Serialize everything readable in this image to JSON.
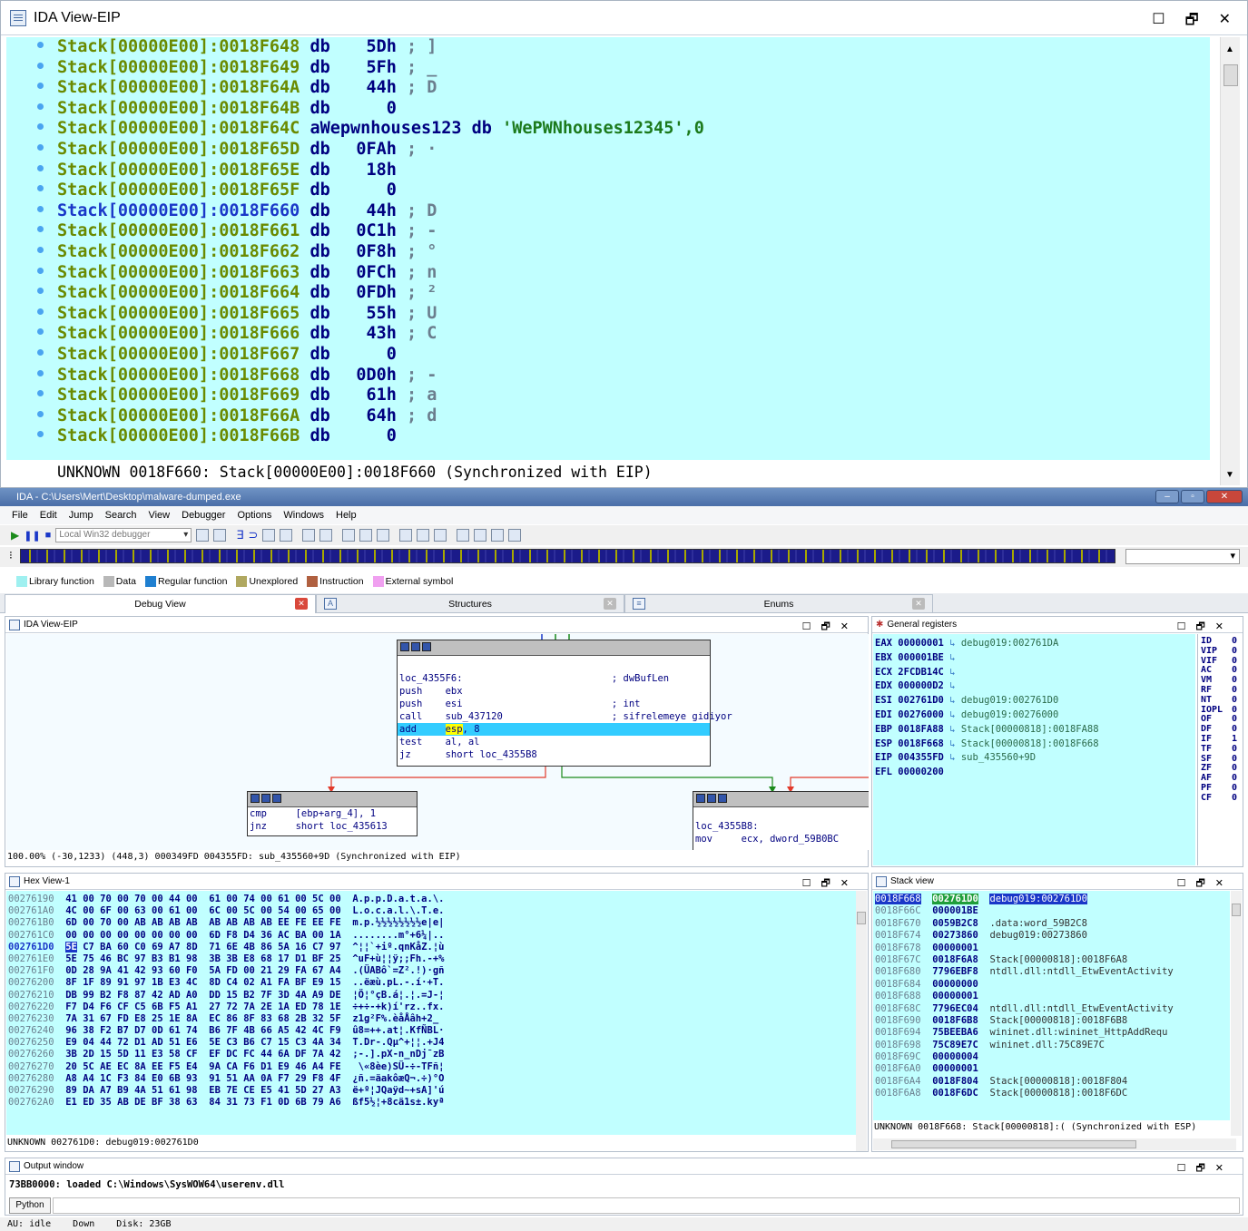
{
  "top_view": {
    "title": "IDA View-EIP",
    "lines": [
      {
        "addr": "Stack[00000E00]:0018F648",
        "op": "db",
        "val": "5Dh",
        "cmt": "; ]"
      },
      {
        "addr": "Stack[00000E00]:0018F649",
        "op": "db",
        "val": "5Fh",
        "cmt": "; _"
      },
      {
        "addr": "Stack[00000E00]:0018F64A",
        "op": "db",
        "val": "44h",
        "cmt": "; D"
      },
      {
        "addr": "Stack[00000E00]:0018F64B",
        "op": "db",
        "val": "0",
        "cmt": ""
      },
      {
        "addr": "Stack[00000E00]:0018F64C",
        "op": "aWepwnhouses123 db",
        "val": "'WePWNhouses12345',0",
        "cmt": "",
        "str": true
      },
      {
        "addr": "Stack[00000E00]:0018F65D",
        "op": "db",
        "val": "0FAh",
        "cmt": "; ·"
      },
      {
        "addr": "Stack[00000E00]:0018F65E",
        "op": "db",
        "val": "18h",
        "cmt": ""
      },
      {
        "addr": "Stack[00000E00]:0018F65F",
        "op": "db",
        "val": "0",
        "cmt": ""
      },
      {
        "addr": "Stack[00000E00]:0018F660",
        "op": "db",
        "val": "44h",
        "cmt": "; D",
        "sel": true
      },
      {
        "addr": "Stack[00000E00]:0018F661",
        "op": "db",
        "val": "0C1h",
        "cmt": "; -"
      },
      {
        "addr": "Stack[00000E00]:0018F662",
        "op": "db",
        "val": "0F8h",
        "cmt": "; °"
      },
      {
        "addr": "Stack[00000E00]:0018F663",
        "op": "db",
        "val": "0FCh",
        "cmt": "; n"
      },
      {
        "addr": "Stack[00000E00]:0018F664",
        "op": "db",
        "val": "0FDh",
        "cmt": "; ²"
      },
      {
        "addr": "Stack[00000E00]:0018F665",
        "op": "db",
        "val": "55h",
        "cmt": "; U"
      },
      {
        "addr": "Stack[00000E00]:0018F666",
        "op": "db",
        "val": "43h",
        "cmt": "; C"
      },
      {
        "addr": "Stack[00000E00]:0018F667",
        "op": "db",
        "val": "0",
        "cmt": ""
      },
      {
        "addr": "Stack[00000E00]:0018F668",
        "op": "db",
        "val": "0D0h",
        "cmt": "; -"
      },
      {
        "addr": "Stack[00000E00]:0018F669",
        "op": "db",
        "val": "61h",
        "cmt": "; a"
      },
      {
        "addr": "Stack[00000E00]:0018F66A",
        "op": "db",
        "val": "64h",
        "cmt": "; d"
      },
      {
        "addr": "Stack[00000E00]:0018F66B",
        "op": "db",
        "val": "0",
        "cmt": ""
      }
    ],
    "status": "UNKNOWN 0018F660: Stack[00000E00]:0018F660 (Synchronized with EIP)"
  },
  "window": {
    "title": "IDA - C:\\Users\\Mert\\Desktop\\malware-dumped.exe",
    "menu": [
      "File",
      "Edit",
      "Jump",
      "Search",
      "View",
      "Debugger",
      "Options",
      "Windows",
      "Help"
    ],
    "debugger_select": "Local Win32 debugger"
  },
  "legend": [
    {
      "label": "Library function",
      "color": "#9ff0f0"
    },
    {
      "label": "Data",
      "color": "#b8b8b8"
    },
    {
      "label": "Regular function",
      "color": "#1f7fd0"
    },
    {
      "label": "Unexplored",
      "color": "#b0a860"
    },
    {
      "label": "Instruction",
      "color": "#b06040"
    },
    {
      "label": "External symbol",
      "color": "#f0a0f0"
    }
  ],
  "tabs": [
    "Debug View",
    "Structures",
    "Enums"
  ],
  "graph_view": {
    "title": "IDA View-EIP",
    "main_block": [
      {
        "t": "loc_4355F6:                          ; dwBufLen"
      },
      {
        "t": "push    ebx"
      },
      {
        "t": "push    esi                          ; int"
      },
      {
        "t": "call    sub_437120                   ; sifrelemeye gidiyor"
      },
      {
        "t": "add     esp, 8",
        "hl": true
      },
      {
        "t": "test    al, al"
      },
      {
        "t": "jz      short loc_4355B8"
      }
    ],
    "left_block": [
      {
        "t": "cmp     [ebp+arg_4], 1"
      },
      {
        "t": "jnz     short loc_435613"
      }
    ],
    "right_block": [
      {
        "t": "loc_4355B8:"
      },
      {
        "t": "mov     ecx, dword_59B0BC"
      }
    ],
    "status": "100.00% (-30,1233) (448,3) 000349FD 004355FD: sub_435560+9D (Synchronized with EIP)"
  },
  "registers": {
    "title": "General registers",
    "rows": [
      {
        "n": "EAX",
        "v": "00000001",
        "d": "debug019:002761DA"
      },
      {
        "n": "EBX",
        "v": "000001BE",
        "d": ""
      },
      {
        "n": "ECX",
        "v": "2FCDB14C",
        "d": ""
      },
      {
        "n": "EDX",
        "v": "000000D2",
        "d": ""
      },
      {
        "n": "ESI",
        "v": "002761D0",
        "d": "debug019:002761D0"
      },
      {
        "n": "EDI",
        "v": "00276000",
        "d": "debug019:00276000"
      },
      {
        "n": "EBP",
        "v": "0018FA88",
        "d": "Stack[00000818]:0018FA88"
      },
      {
        "n": "ESP",
        "v": "0018F668",
        "d": "Stack[00000818]:0018F668"
      },
      {
        "n": "EIP",
        "v": "004355FD",
        "d": "sub_435560+9D"
      },
      {
        "n": "EFL",
        "v": "00000200",
        "d": ""
      }
    ],
    "flags": [
      {
        "n": "ID",
        "v": "0"
      },
      {
        "n": "VIP",
        "v": "0"
      },
      {
        "n": "VIF",
        "v": "0"
      },
      {
        "n": "AC",
        "v": "0"
      },
      {
        "n": "VM",
        "v": "0"
      },
      {
        "n": "RF",
        "v": "0"
      },
      {
        "n": "NT",
        "v": "0"
      },
      {
        "n": "IOPL",
        "v": "0"
      },
      {
        "n": "OF",
        "v": "0"
      },
      {
        "n": "DF",
        "v": "0"
      },
      {
        "n": "IF",
        "v": "1"
      },
      {
        "n": "TF",
        "v": "0"
      },
      {
        "n": "SF",
        "v": "0"
      },
      {
        "n": "ZF",
        "v": "0"
      },
      {
        "n": "AF",
        "v": "0"
      },
      {
        "n": "PF",
        "v": "0"
      },
      {
        "n": "CF",
        "v": "0"
      }
    ]
  },
  "hex_view": {
    "title": "Hex View-1",
    "rows": [
      {
        "a": "00276190",
        "h": "41 00 70 00 70 00 44 00  61 00 74 00 61 00 5C 00",
        "s": "A.p.p.D.a.t.a.\\."
      },
      {
        "a": "002761A0",
        "h": "4C 00 6F 00 63 00 61 00  6C 00 5C 00 54 00 65 00",
        "s": "L.o.c.a.l.\\.T.e."
      },
      {
        "a": "002761B0",
        "h": "6D 00 70 00 AB AB AB AB  AB AB AB AB EE FE EE FE",
        "s": "m.p.½½½½½½½½e|e|"
      },
      {
        "a": "002761C0",
        "h": "00 00 00 00 00 00 00 00  6D F8 D4 36 AC BA 00 1A",
        "s": "........m°+6¼|.."
      },
      {
        "a": "002761D0",
        "sel": "5E",
        "h": " C7 BA 60 C0 69 A7 8D  71 6E 4B 86 5A 16 C7 97",
        "s": "^¦¦`+iº.qnKåZ.¦ù",
        "cur": true
      },
      {
        "a": "002761E0",
        "h": "5E 75 46 BC 97 B3 B1 98  3B 3B E8 68 17 D1 BF 25",
        "s": "^uF+ù¦¦ÿ;;Fh.-+%"
      },
      {
        "a": "002761F0",
        "h": "0D 28 9A 41 42 93 60 F0  5A FD 00 21 29 FA 67 A4",
        "s": ".(ÜABô`=Z².!)·gñ"
      },
      {
        "a": "00276200",
        "h": "8F 1F 89 91 97 1B E3 4C  8D C4 02 A1 FA BF E9 15",
        "s": "..ëæù.pL.-.í·+T."
      },
      {
        "a": "00276210",
        "h": "DB 99 B2 F8 87 42 AD A0  DD 15 B2 7F 3D 4A A9 DE",
        "s": "¦Ö¦°çB.á¦.¦.=J-¦"
      },
      {
        "a": "00276220",
        "h": "F7 D4 F6 CF C5 6B F5 A1  27 72 7A 2E 1A ED 78 1E",
        "s": "÷+÷-+k)í'rz..fx."
      },
      {
        "a": "00276230",
        "h": "7A 31 67 FD E8 25 1E 8A  EC 86 8F 83 68 2B 32 5F",
        "s": "z1g²F%.èåÅâh+2_"
      },
      {
        "a": "00276240",
        "h": "96 38 F2 B7 D7 0D 61 74  B6 7F 4B 66 A5 42 4C F9",
        "s": "û8=++.at¦.KfÑBL·"
      },
      {
        "a": "00276250",
        "h": "E9 04 44 72 D1 AD 51 E6  5E C3 B6 C7 15 C3 4A 34",
        "s": "T.Dr-.Qµ^+¦¦.+J4"
      },
      {
        "a": "00276260",
        "h": "3B 2D 15 5D 11 E3 58 CF  EF DC FC 44 6A DF 7A 42",
        "s": ";-.].pX-n_nDj¯zB"
      },
      {
        "a": "00276270",
        "h": "20 5C AE EC 8A EE F5 E4  9A CA F6 D1 E9 46 A4 FE",
        "s": " \\«8èe)SÜ-÷-TFñ¦"
      },
      {
        "a": "00276280",
        "h": "A8 A4 1C F3 84 E0 6B 93  91 51 AA 0A F7 29 F8 4F",
        "s": "¿ñ.=äakôæQ¬.÷)°O"
      },
      {
        "a": "00276290",
        "h": "89 DA A7 B9 4A 51 61 98  EB 7E CE E5 41 5D 27 A3",
        "s": "ë+º¦JQaÿd~+sA]'ú"
      },
      {
        "a": "002762A0",
        "h": "E1 ED 35 AB DE BF 38 63  84 31 73 F1 0D 6B 79 A6",
        "s": "ßf5½¦+8cä1s±.kyª"
      }
    ],
    "status": "UNKNOWN 002761D0: debug019:002761D0"
  },
  "stack_view": {
    "title": "Stack view",
    "rows": [
      {
        "a": "0018F668",
        "v": "002761D0",
        "d": "debug019:002761D0",
        "top": true
      },
      {
        "a": "0018F66C",
        "v": "000001BE",
        "d": ""
      },
      {
        "a": "0018F670",
        "v": "0059B2C8",
        "d": ".data:word_59B2C8"
      },
      {
        "a": "0018F674",
        "v": "00273860",
        "d": "debug019:00273860"
      },
      {
        "a": "0018F678",
        "v": "00000001",
        "d": ""
      },
      {
        "a": "0018F67C",
        "v": "0018F6A8",
        "d": "Stack[00000818]:0018F6A8"
      },
      {
        "a": "0018F680",
        "v": "7796EBF8",
        "d": "ntdll.dll:ntdll_EtwEventActivity"
      },
      {
        "a": "0018F684",
        "v": "00000000",
        "d": ""
      },
      {
        "a": "0018F688",
        "v": "00000001",
        "d": ""
      },
      {
        "a": "0018F68C",
        "v": "7796EC04",
        "d": "ntdll.dll:ntdll_EtwEventActivity"
      },
      {
        "a": "0018F690",
        "v": "0018F6B8",
        "d": "Stack[00000818]:0018F6B8"
      },
      {
        "a": "0018F694",
        "v": "75BEEBA6",
        "d": "wininet.dll:wininet_HttpAddRequ"
      },
      {
        "a": "0018F698",
        "v": "75C89E7C",
        "d": "wininet.dll:75C89E7C"
      },
      {
        "a": "0018F69C",
        "v": "00000004",
        "d": ""
      },
      {
        "a": "0018F6A0",
        "v": "00000001",
        "d": ""
      },
      {
        "a": "0018F6A4",
        "v": "0018F804",
        "d": "Stack[00000818]:0018F804"
      },
      {
        "a": "0018F6A8",
        "v": "0018F6DC",
        "d": "Stack[00000818]:0018F6DC"
      }
    ],
    "status": "UNKNOWN 0018F668: Stack[00000818]:( (Synchronized with ESP)"
  },
  "output": {
    "title": "Output window",
    "line": "73BB0000: loaded C:\\Windows\\SysWOW64\\userenv.dll",
    "python_label": "Python"
  },
  "statusbar": {
    "au": "AU:  idle",
    "dir": "Down",
    "disk": "Disk: 23GB"
  }
}
